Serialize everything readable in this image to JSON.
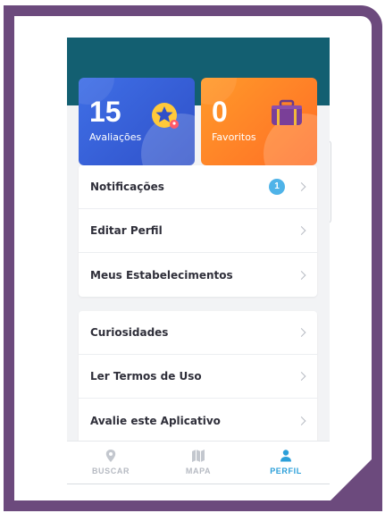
{
  "stats": {
    "reviews": {
      "count": "15",
      "label": "Avaliações"
    },
    "favorites": {
      "count": "0",
      "label": "Favoritos"
    }
  },
  "menu_primary": {
    "items": [
      {
        "label": "Notificações",
        "badge": "1"
      },
      {
        "label": "Editar Perfil"
      },
      {
        "label": "Meus Estabelecimentos"
      }
    ]
  },
  "menu_secondary": {
    "items": [
      {
        "label": "Curiosidades"
      },
      {
        "label": "Ler Termos de Uso"
      },
      {
        "label": "Avalie este Aplicativo"
      }
    ]
  },
  "bottom_nav": {
    "items": [
      {
        "label": "BUSCAR",
        "icon": "location-pin-icon"
      },
      {
        "label": "MAPA",
        "icon": "map-icon"
      },
      {
        "label": "PERFIL",
        "icon": "user-icon",
        "active": true
      }
    ]
  },
  "colors": {
    "frame": "#6c4a7d",
    "header": "#135f71",
    "blue_card": "#3f6fe6",
    "orange_card": "#ff7a25",
    "accent": "#2b9fd9",
    "badge": "#4fb3e8"
  }
}
